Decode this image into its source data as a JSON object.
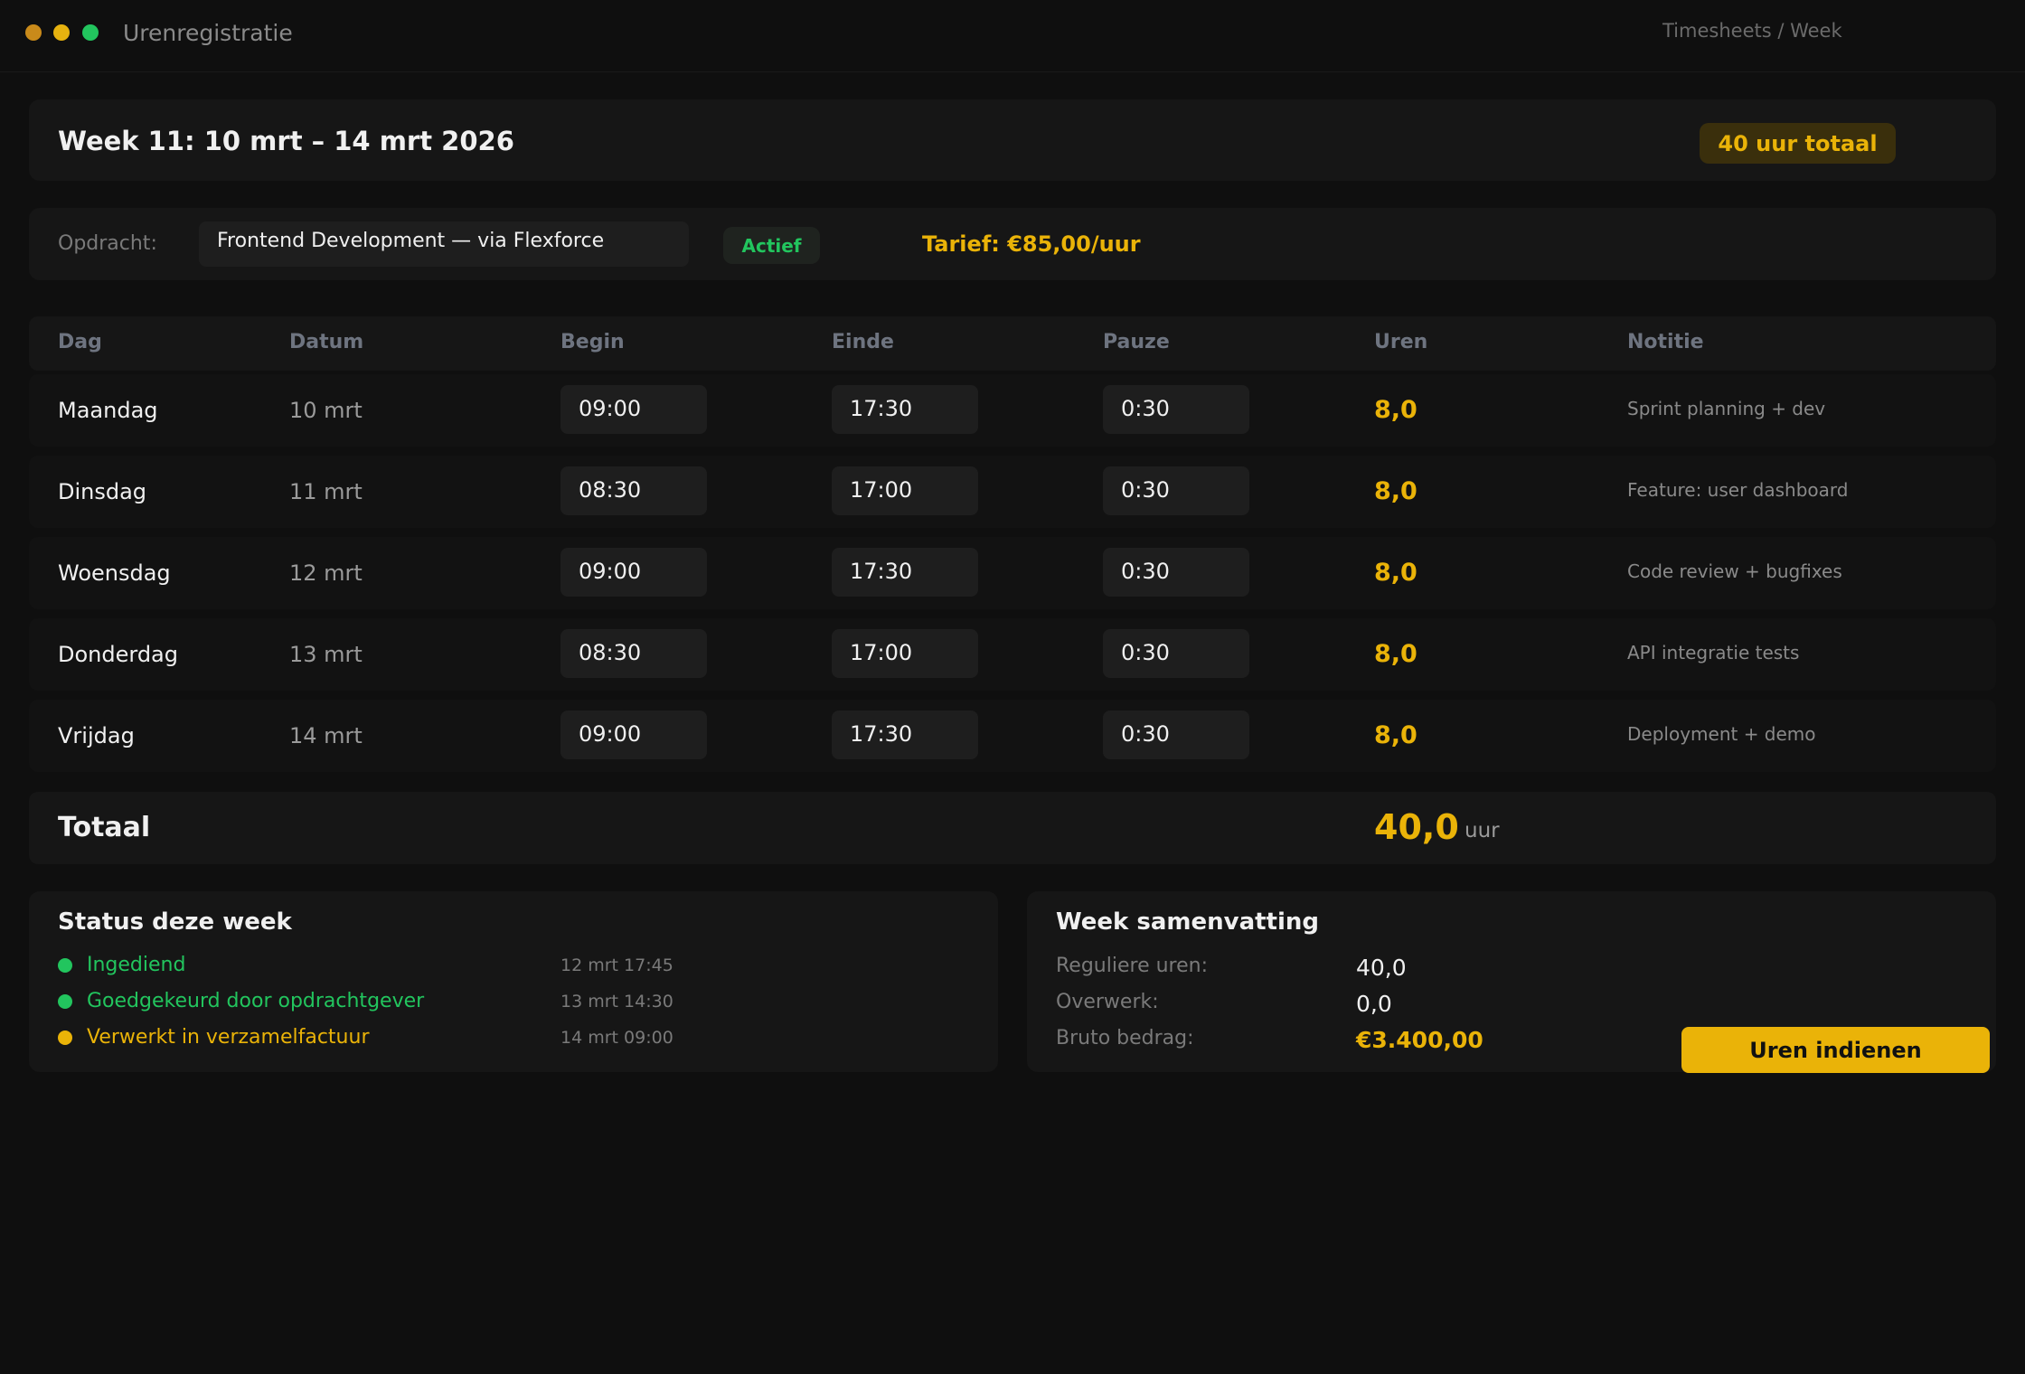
{
  "window": {
    "title": "Urenregistratie",
    "breadcrumb": "Timesheets / Week"
  },
  "header": {
    "week_title": "Week 11: 10 mrt – 14 mrt 2026",
    "total_badge": "40 uur totaal"
  },
  "assignment": {
    "label": "Opdracht:",
    "value": "Frontend Development — via Flexforce",
    "status": "Actief",
    "rate": "Tarief: €85,00/uur"
  },
  "table": {
    "headers": [
      "Dag",
      "Datum",
      "Begin",
      "Einde",
      "Pauze",
      "Uren",
      "Notitie"
    ],
    "rows": [
      {
        "day": "Maandag",
        "date": "10 mrt",
        "begin": "09:00",
        "end": "17:30",
        "pause": "0:30",
        "hours": "8,0",
        "note": "Sprint planning + dev"
      },
      {
        "day": "Dinsdag",
        "date": "11 mrt",
        "begin": "08:30",
        "end": "17:00",
        "pause": "0:30",
        "hours": "8,0",
        "note": "Feature: user dashboard"
      },
      {
        "day": "Woensdag",
        "date": "12 mrt",
        "begin": "09:00",
        "end": "17:30",
        "pause": "0:30",
        "hours": "8,0",
        "note": "Code review + bugfixes"
      },
      {
        "day": "Donderdag",
        "date": "13 mrt",
        "begin": "08:30",
        "end": "17:00",
        "pause": "0:30",
        "hours": "8,0",
        "note": "API integratie tests"
      },
      {
        "day": "Vrijdag",
        "date": "14 mrt",
        "begin": "09:00",
        "end": "17:30",
        "pause": "0:30",
        "hours": "8,0",
        "note": "Deployment + demo"
      }
    ],
    "total_label": "Totaal",
    "total_value": "40,0",
    "total_unit": "uur"
  },
  "status": {
    "title": "Status deze week",
    "items": [
      {
        "text": "Ingediend",
        "time": "12 mrt 17:45",
        "color": "#22c55e"
      },
      {
        "text": "Goedgekeurd door opdrachtgever",
        "time": "13 mrt 14:30",
        "color": "#22c55e"
      },
      {
        "text": "Verwerkt in verzamelfactuur",
        "time": "14 mrt 09:00",
        "color": "#eab308"
      }
    ]
  },
  "summary": {
    "title": "Week samenvatting",
    "regular_label": "Reguliere uren:",
    "regular_value": "40,0",
    "overtime_label": "Overwerk:",
    "overtime_value": "0,0",
    "gross_label": "Bruto bedrag:",
    "gross_value": "€3.400,00"
  },
  "actions": {
    "submit_label": "Uren indienen"
  },
  "colors": {
    "accent": "#eab308",
    "success": "#22c55e",
    "background": "#0f0f0f"
  }
}
